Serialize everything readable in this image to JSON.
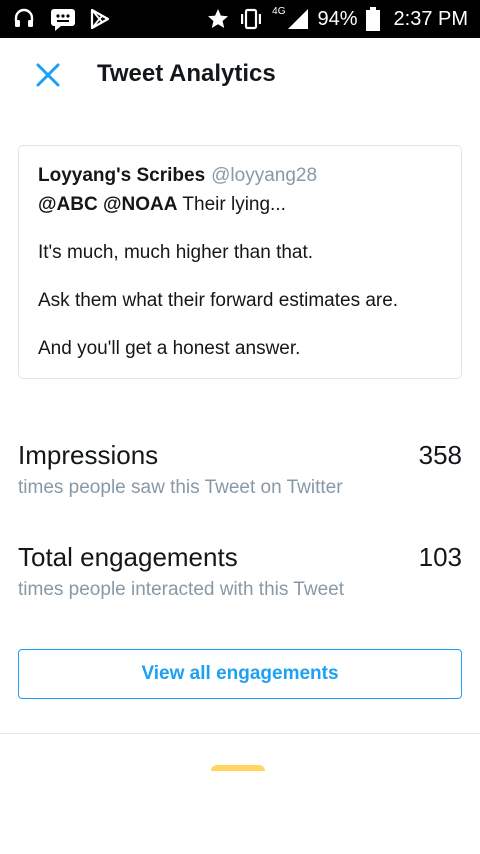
{
  "status_bar": {
    "network": "4G",
    "battery": "94%",
    "time": "2:37 PM",
    "icons": [
      "headset-icon",
      "message-icon",
      "play-store-icon",
      "star-icon",
      "vibrate-icon",
      "signal-icon",
      "battery-icon"
    ]
  },
  "header": {
    "close_icon": "close-icon",
    "title": "Tweet Analytics"
  },
  "tweet": {
    "author_name": "Loyyang's Scribes",
    "author_handle": "@loyyang28",
    "mention_1": "@ABC",
    "mention_2": "@NOAA",
    "line_1_rest": " Their lying...",
    "line_2": "It's much, much higher than that.",
    "line_3": "Ask them what their forward estimates are.",
    "line_4": "And you'll get a honest answer."
  },
  "metrics": {
    "impressions": {
      "label": "Impressions",
      "value": "358",
      "description": "times people saw this Tweet on Twitter"
    },
    "engagements": {
      "label": "Total engagements",
      "value": "103",
      "description": "times people interacted with this Tweet"
    }
  },
  "actions": {
    "view_all_label": "View all engagements"
  },
  "colors": {
    "accent": "#1da1f2",
    "secondary_text": "#8899a6",
    "promo": "#ffd75f"
  }
}
